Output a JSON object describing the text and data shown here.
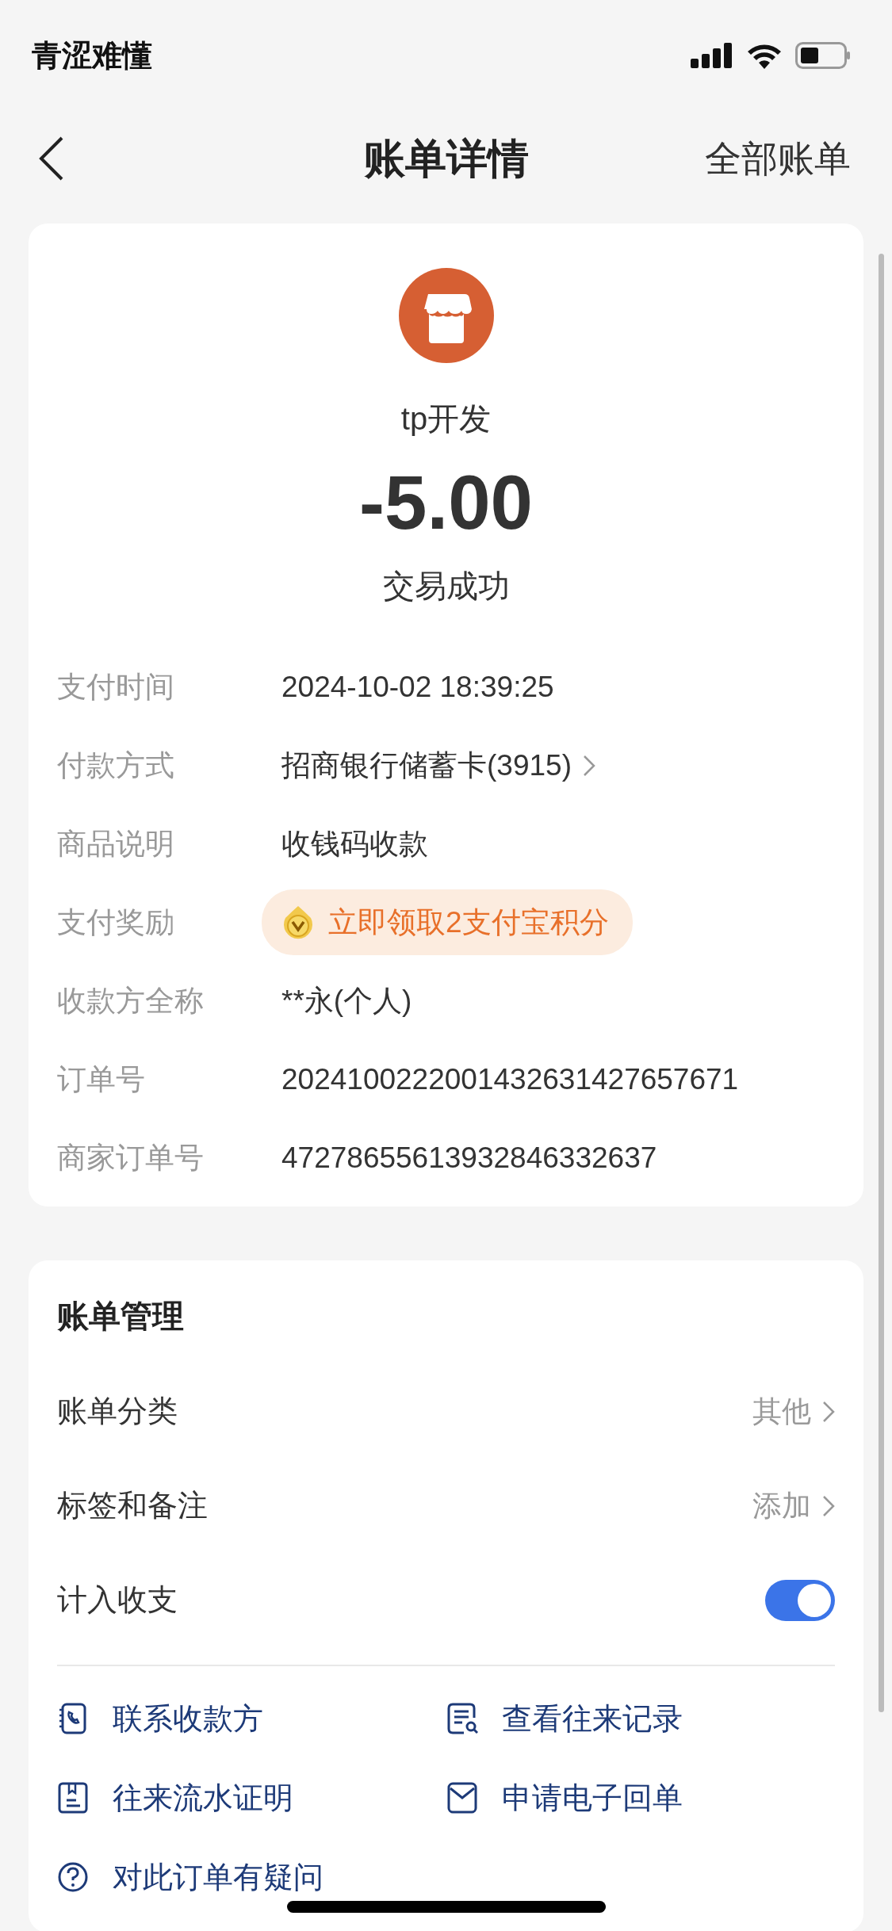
{
  "status_bar": {
    "text": "青涩难懂"
  },
  "nav": {
    "title": "账单详情",
    "action": "全部账单"
  },
  "summary": {
    "merchant": "tp开发",
    "amount": "-5.00",
    "status": "交易成功"
  },
  "details": [
    {
      "kind": "text",
      "label": "支付时间",
      "value": "2024-10-02 18:39:25"
    },
    {
      "kind": "link",
      "label": "付款方式",
      "value": "招商银行储蓄卡(3915)"
    },
    {
      "kind": "text",
      "label": "商品说明",
      "value": "收钱码收款"
    },
    {
      "kind": "reward",
      "label": "支付奖励",
      "value": "立即领取2支付宝积分"
    },
    {
      "kind": "text",
      "label": "收款方全称",
      "value": "**永(个人)"
    },
    {
      "kind": "text",
      "label": "订单号",
      "value": "2024100222001432631427657671"
    },
    {
      "kind": "text",
      "label": "商家订单号",
      "value": "47278655613932846332637"
    }
  ],
  "management": {
    "title": "账单管理",
    "rows": [
      {
        "kind": "link",
        "label": "账单分类",
        "value": "其他"
      },
      {
        "kind": "link",
        "label": "标签和备注",
        "value": "添加"
      },
      {
        "kind": "switch",
        "label": "计入收支",
        "on": true
      }
    ]
  },
  "actions": [
    {
      "label": "联系收款方"
    },
    {
      "label": "查看往来记录"
    },
    {
      "label": "往来流水证明"
    },
    {
      "label": "申请电子回单"
    },
    {
      "label": "对此订单有疑问"
    }
  ]
}
